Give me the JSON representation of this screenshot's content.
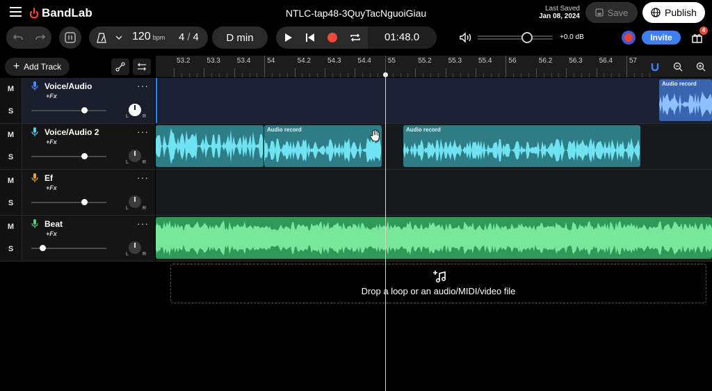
{
  "app": {
    "brand": "BandLab",
    "project_title": "NTLC-tap48-3QuyTacNguoiGiau",
    "last_saved_label": "Last Saved",
    "last_saved_date": "Jan 08, 2024",
    "save_label": "Save",
    "publish_label": "Publish"
  },
  "toolbar": {
    "tempo": "120",
    "tempo_unit": "bpm",
    "time_sig_num": "4",
    "time_sig_sep": "/",
    "time_sig_den": "4",
    "key": "D min",
    "time": "01:48.0",
    "volume_db": "+0.0 dB",
    "volume_level": 0.66,
    "invite_label": "Invite",
    "gift_badge": "4"
  },
  "side": {
    "add_track_label": "Add Track"
  },
  "ruler": {
    "ticks": [
      "53.2",
      "53.3",
      "53.4",
      "54",
      "54.2",
      "54.3",
      "54.4",
      "55",
      "55.2",
      "55.3",
      "55.4",
      "56",
      "56.2",
      "56.3",
      "56.4",
      "57"
    ]
  },
  "tracks": [
    {
      "name": "Voice/Audio",
      "fx": "+Fx",
      "mute": "M",
      "solo": "S",
      "mic_color": "#4a8cff",
      "volume": 0.7,
      "pan_l": "L",
      "pan_r": "R"
    },
    {
      "name": "Voice/Audio 2",
      "fx": "+Fx",
      "mute": "M",
      "solo": "S",
      "mic_color": "#4ecbe0",
      "volume": 0.7,
      "pan_l": "L",
      "pan_r": "R"
    },
    {
      "name": "Ef",
      "fx": "+Fx",
      "mute": "M",
      "solo": "S",
      "mic_color": "#e8a24a",
      "volume": 0.7,
      "pan_l": "L",
      "pan_r": "R"
    },
    {
      "name": "Beat",
      "fx": "+Fx",
      "mute": "M",
      "solo": "S",
      "mic_color": "#4cd07a",
      "volume": 0.15,
      "pan_l": "L",
      "pan_r": "R"
    }
  ],
  "clips": {
    "t1_label": "Audio record",
    "t2a_label": "Audio record",
    "t2b_label": "Audio record"
  },
  "dropzone": {
    "text": "Drop a loop or an audio/MIDI/video file"
  },
  "colors": {
    "accent_blue": "#3d7ff5",
    "clip_teal": "#2e7d86",
    "clip_blue": "#3a64b0",
    "beat_green": "#2f9a58"
  }
}
